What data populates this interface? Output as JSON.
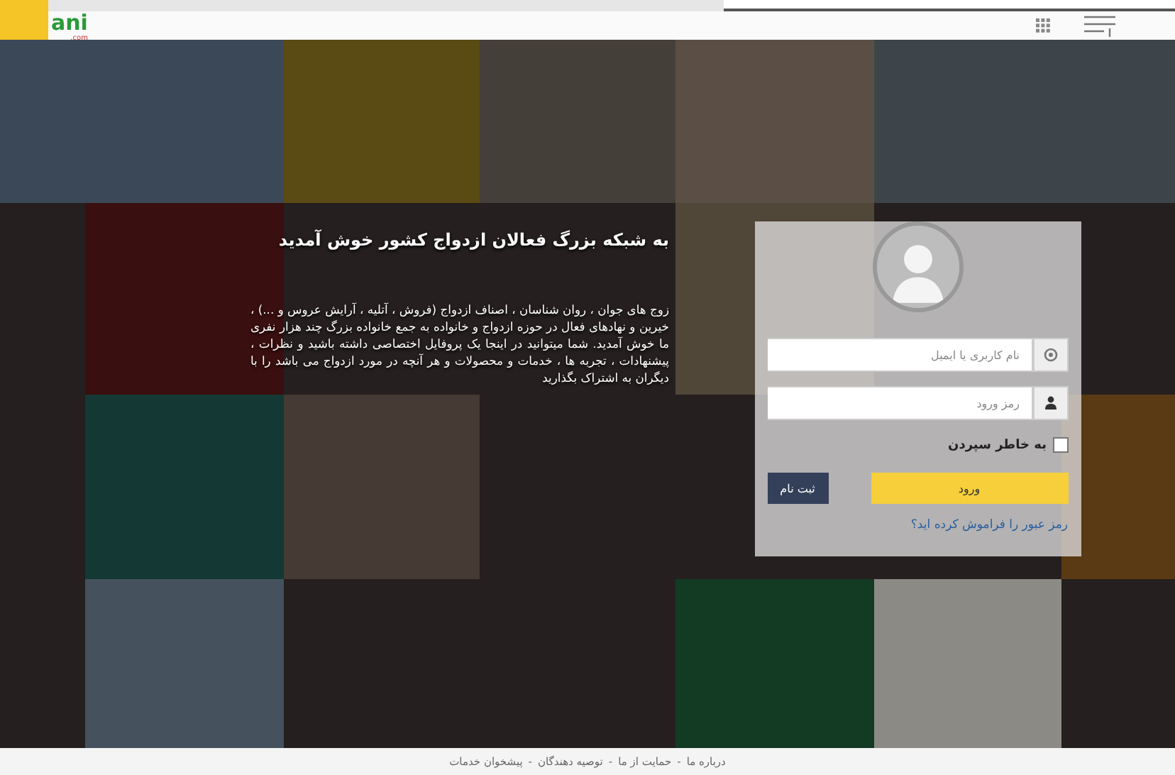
{
  "header": {
    "logo": {
      "name": "ani",
      "domain": ".com"
    }
  },
  "welcome": {
    "title": "به شبکه بزرگ فعالان ازدواج کشور خوش آمدید",
    "text": "زوج های جوان ، روان شناسان ، اصناف ازدواج (فروش ، آتلیه ، آرایش عروس و ...) ، خیرین و نهادهای فعال در حوزه ازدواج و خانواده به جمع خانواده بزرگ چند هزار نفری ما خوش آمدید. شما میتوانید در اینجا یک پروفایل اختصاصی داشته باشید و نظرات ، پیشنهادات ، تجربه ها ، خدمات و محصولات و هر آنچه در مورد ازدواج می باشد را با دیگران به اشتراک بگذارید"
  },
  "login": {
    "username": {
      "placeholder": "نام کاربری یا ایمیل"
    },
    "password": {
      "placeholder": "رمز ورود"
    },
    "remember": {
      "label": "به خاطر سپردن",
      "checked": false
    },
    "login_button": "ورود",
    "register_button": "ثبت نام",
    "forgot_link": "رمز عبور را فراموش کرده اید؟"
  },
  "footer": {
    "links": [
      "درباره ما",
      "حمایت از ما",
      "توصیه دهندگان",
      "پیشخوان خدمات"
    ],
    "separator": "-"
  }
}
